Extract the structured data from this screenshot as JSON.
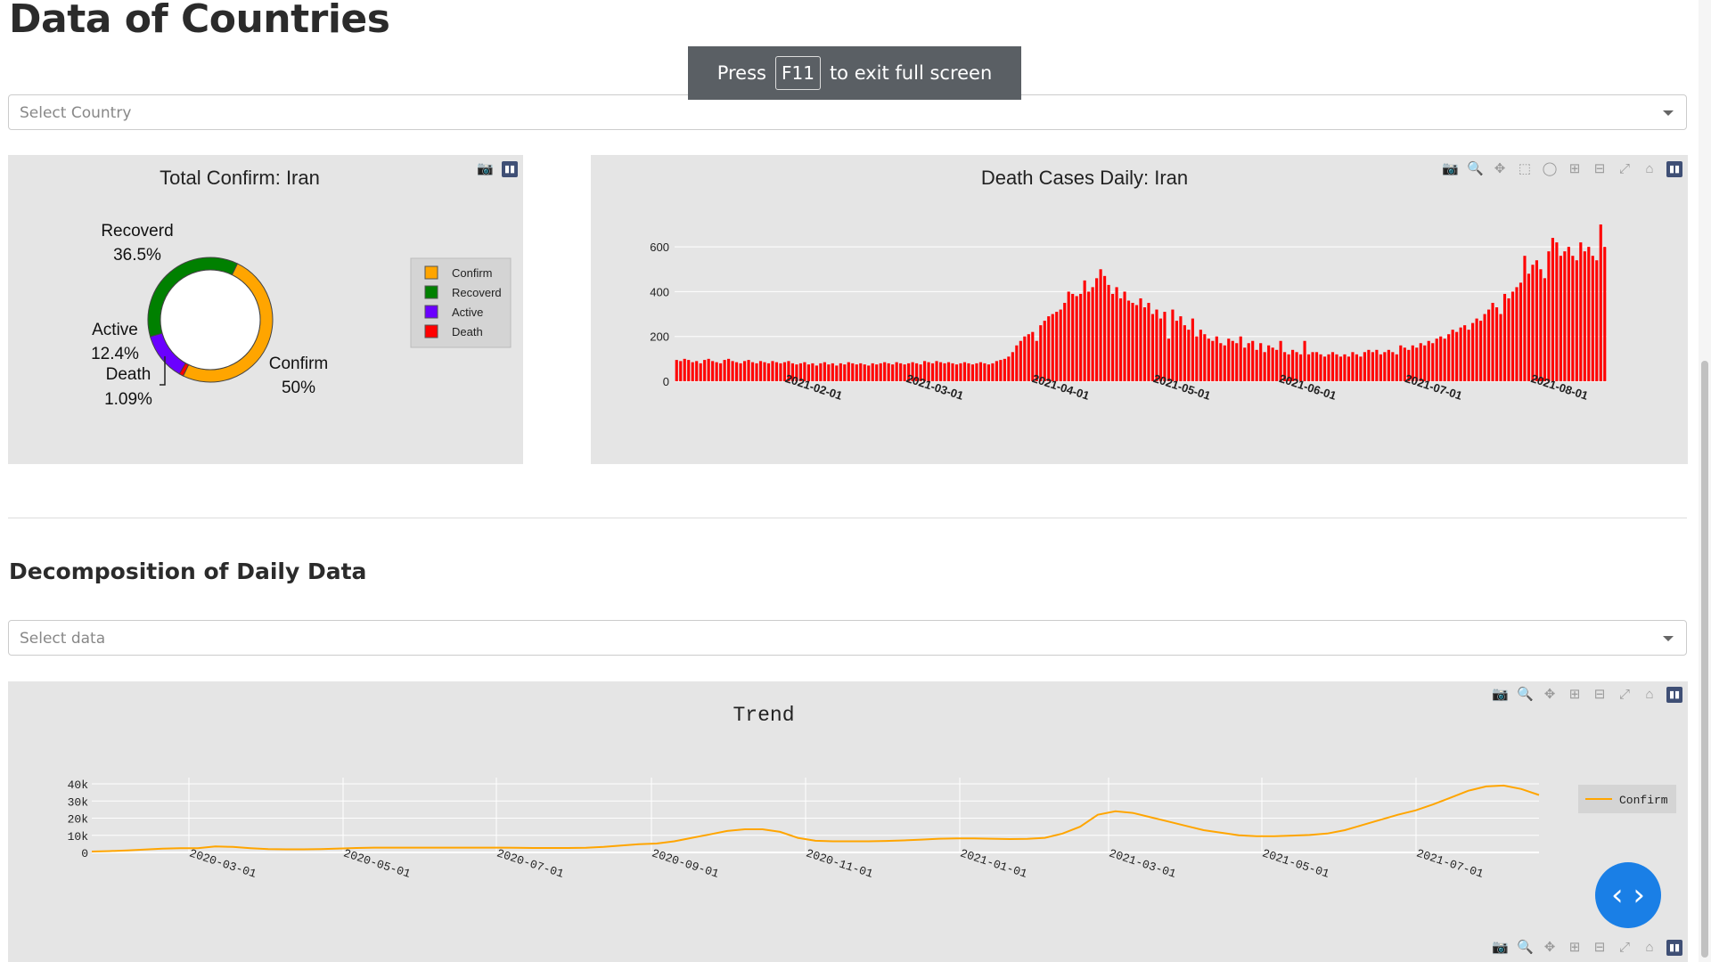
{
  "page": {
    "title": "Data of Countries"
  },
  "toast": {
    "prefix": "Press",
    "key": "F11",
    "suffix": "to exit full screen"
  },
  "country_select": {
    "placeholder": "Select Country"
  },
  "section2": {
    "title": "Decomposition of Daily Data"
  },
  "data_select": {
    "placeholder": "Select data"
  },
  "fab": {
    "icon": "code-icon",
    "label": "‹ ›"
  },
  "colors": {
    "confirm": "#ffa500",
    "recovered": "#008000",
    "active": "#6a00ff",
    "death": "#ff0000",
    "panel_bg": "#e5e5e5"
  },
  "chart_data": [
    {
      "type": "pie",
      "hole": true,
      "title": "Total Confirm: Iran",
      "labels": [
        "Confirm",
        "Recoverd",
        "Active",
        "Death"
      ],
      "slice_labels": [
        {
          "name": "Confirm",
          "pct": "50%"
        },
        {
          "name": "Recoverd",
          "pct": "36.5%"
        },
        {
          "name": "Active",
          "pct": "12.4%"
        },
        {
          "name": "Death",
          "pct": "1.09%"
        }
      ],
      "values": [
        50,
        36.5,
        12.4,
        1.09
      ],
      "colors": [
        "#ffa500",
        "#008000",
        "#6a00ff",
        "#ff0000"
      ],
      "legend": [
        "Confirm",
        "Recoverd",
        "Active",
        "Death"
      ],
      "legend_position": "right"
    },
    {
      "type": "bar",
      "title": "Death Cases Daily:  Iran",
      "x_tick_labels": [
        "2021-02-01",
        "2021-03-01",
        "2021-04-01",
        "2021-05-01",
        "2021-06-01",
        "2021-07-01",
        "2021-08-01"
      ],
      "y_tick_labels": [
        "0",
        "200",
        "400",
        "600"
      ],
      "ylim": [
        0,
        700
      ],
      "color": "#ff0000",
      "values": [
        95,
        90,
        100,
        95,
        85,
        90,
        80,
        95,
        100,
        90,
        85,
        80,
        95,
        100,
        90,
        85,
        80,
        90,
        95,
        85,
        80,
        90,
        85,
        80,
        90,
        85,
        80,
        85,
        90,
        80,
        75,
        80,
        85,
        75,
        80,
        70,
        80,
        85,
        75,
        80,
        70,
        80,
        75,
        85,
        80,
        75,
        80,
        75,
        70,
        80,
        75,
        80,
        85,
        80,
        75,
        85,
        80,
        75,
        80,
        85,
        80,
        75,
        90,
        85,
        80,
        90,
        85,
        80,
        85,
        80,
        75,
        80,
        85,
        80,
        75,
        80,
        85,
        80,
        75,
        80,
        90,
        95,
        100,
        110,
        130,
        160,
        180,
        200,
        210,
        220,
        180,
        250,
        270,
        290,
        300,
        310,
        320,
        350,
        400,
        390,
        380,
        390,
        450,
        400,
        420,
        460,
        500,
        470,
        430,
        390,
        420,
        370,
        400,
        360,
        350,
        340,
        370,
        330,
        350,
        300,
        320,
        280,
        310,
        190,
        320,
        270,
        290,
        250,
        230,
        280,
        200,
        230,
        210,
        190,
        180,
        200,
        170,
        160,
        190,
        180,
        170,
        200,
        150,
        170,
        180,
        140,
        170,
        130,
        160,
        150,
        140,
        180,
        130,
        120,
        140,
        130,
        120,
        180,
        120,
        130,
        130,
        120,
        110,
        120,
        130,
        120,
        110,
        120,
        110,
        130,
        120,
        110,
        130,
        140,
        130,
        140,
        120,
        130,
        140,
        130,
        120,
        160,
        150,
        140,
        160,
        150,
        170,
        160,
        180,
        170,
        190,
        200,
        190,
        210,
        230,
        220,
        240,
        250,
        230,
        260,
        280,
        270,
        300,
        320,
        350,
        330,
        300,
        390,
        370,
        400,
        420,
        440,
        560,
        480,
        520,
        540,
        500,
        460,
        580,
        640,
        620,
        560,
        580,
        600,
        560,
        540,
        620,
        580,
        600,
        560,
        540,
        700,
        600
      ]
    },
    {
      "type": "line",
      "title": "Trend",
      "series": [
        {
          "name": "Confirm",
          "color": "#ffa500"
        }
      ],
      "x_tick_labels": [
        "2020-03-01",
        "2020-05-01",
        "2020-07-01",
        "2020-09-01",
        "2020-11-01",
        "2021-01-01",
        "2021-03-01",
        "2021-05-01",
        "2021-07-01"
      ],
      "y_tick_labels": [
        "0",
        "10k",
        "20k",
        "30k",
        "40k"
      ],
      "ylim": [
        0,
        40000
      ],
      "values": [
        500,
        800,
        1200,
        1700,
        2200,
        2500,
        2500,
        3500,
        3200,
        2500,
        2000,
        1800,
        1800,
        2000,
        2300,
        2600,
        2800,
        2800,
        2800,
        2800,
        2800,
        2800,
        2800,
        2800,
        2700,
        2600,
        2600,
        2600,
        2700,
        3200,
        4000,
        4800,
        5200,
        6500,
        8500,
        10500,
        12500,
        13500,
        13500,
        12000,
        8500,
        6800,
        6500,
        6500,
        6500,
        6700,
        7000,
        7500,
        8000,
        8200,
        8200,
        8000,
        7800,
        7900,
        8500,
        11000,
        15000,
        22000,
        24000,
        23000,
        20500,
        18000,
        15500,
        13000,
        11500,
        10000,
        9500,
        9500,
        9800,
        10200,
        11000,
        13000,
        16000,
        19000,
        22000,
        24500,
        28000,
        32000,
        36000,
        38500,
        39000,
        37000,
        33500
      ]
    }
  ]
}
